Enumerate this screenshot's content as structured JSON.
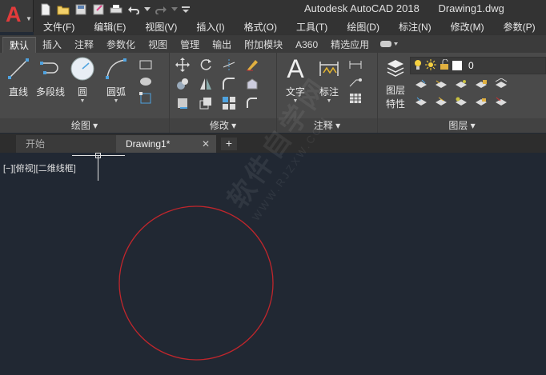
{
  "window": {
    "app_title": "Autodesk AutoCAD 2018",
    "file_title": "Drawing1.dwg"
  },
  "app_button": {
    "letter": "A"
  },
  "menu": [
    "文件(F)",
    "编辑(E)",
    "视图(V)",
    "插入(I)",
    "格式(O)",
    "工具(T)",
    "绘图(D)",
    "标注(N)",
    "修改(M)",
    "参数(P)"
  ],
  "ribbon_tabs": [
    "默认",
    "插入",
    "注释",
    "参数化",
    "视图",
    "管理",
    "输出",
    "附加模块",
    "A360",
    "精选应用"
  ],
  "ribbon": {
    "draw_panel": {
      "title": "绘图",
      "tools": [
        "直线",
        "多段线",
        "圆",
        "圆弧"
      ]
    },
    "modify_panel": {
      "title": "修改"
    },
    "annotation_panel": {
      "title": "注释",
      "tools": [
        "文字",
        "标注"
      ]
    },
    "layers_panel": {
      "title": "图层",
      "layer_props_line1": "图层",
      "layer_props_line2": "特性",
      "current_layer": "0"
    }
  },
  "doc_tabs": {
    "start": "开始",
    "drawing": "Drawing1*",
    "close": "✕",
    "new": "+"
  },
  "viewport": {
    "label": "[−][俯视][二维线框]"
  },
  "watermark": {
    "main": "软件自学网",
    "sub": "WWW.RJZXW.COM"
  },
  "colors": {
    "circle": "#c0262c",
    "accent_red": "#e23b3b",
    "canvas_bg": "#212833"
  }
}
